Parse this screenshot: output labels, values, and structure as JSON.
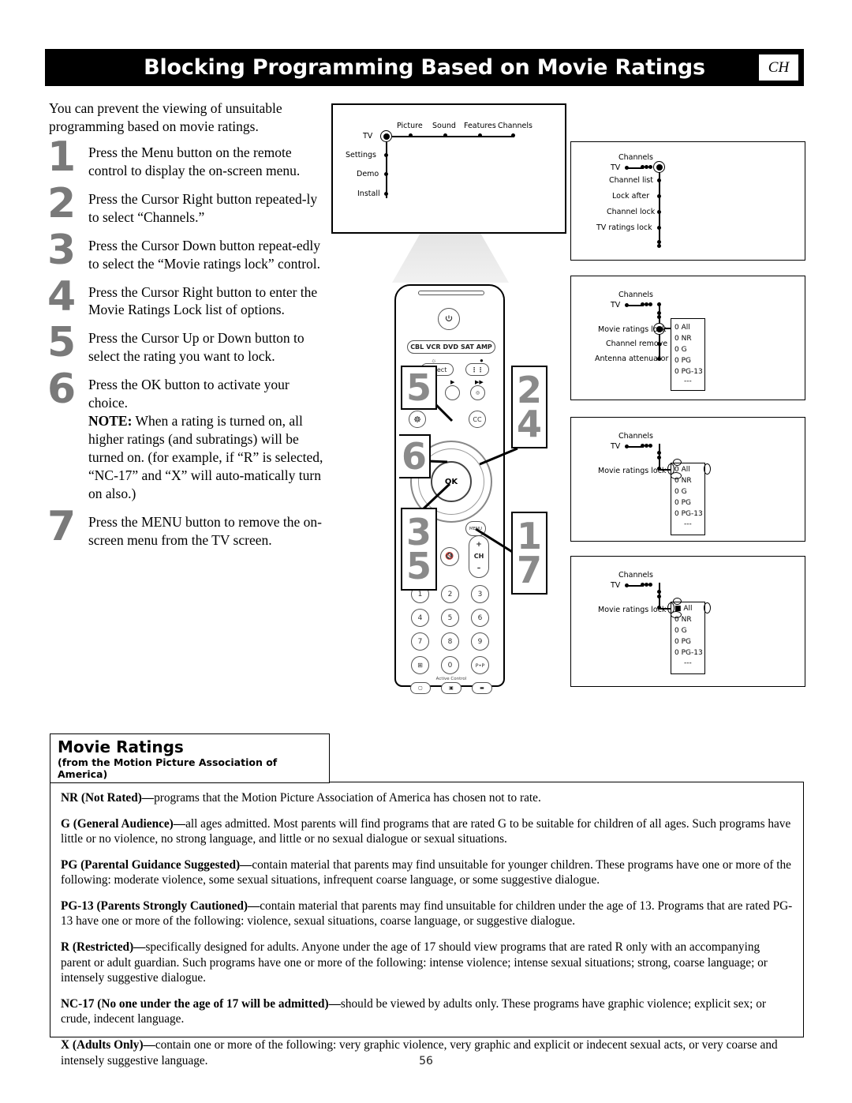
{
  "header": {
    "title": "Blocking Programming Based on Movie Ratings",
    "tab_label": "CH"
  },
  "intro": "You can prevent the viewing of unsuitable programming based on movie ratings.",
  "steps": [
    {
      "num": "1",
      "text": "Press the Menu button on the remote control to display the on-screen menu."
    },
    {
      "num": "2",
      "text": "Press the Cursor Right button repeated-ly to select “Channels.”"
    },
    {
      "num": "3",
      "text": "Press the Cursor Down button repeat-edly to select the “Movie ratings lock” control."
    },
    {
      "num": "4",
      "text": "Press the Cursor Right button to enter the Movie Ratings Lock list of options."
    },
    {
      "num": "5",
      "text": "Press the Cursor Up or Down button to select the rating you want to lock."
    },
    {
      "num": "6",
      "text": "Press the OK button to activate your choice.",
      "note_label": "NOTE:",
      "note": " When a rating is turned on, all higher ratings (and subratings) will be turned on. (for example, if “R” is selected, “NC-17” and “X” will auto-matically turn on also.)"
    },
    {
      "num": "7",
      "text": "Press the MENU button to remove the on-screen menu from the TV screen."
    }
  ],
  "tv_menu": {
    "root": "TV",
    "across": [
      "Picture",
      "Sound",
      "Features",
      "Channels"
    ],
    "down": [
      "Settings",
      "Demo",
      "Install"
    ]
  },
  "panels": [
    {
      "id": "panel-channels",
      "root": "TV",
      "hub_label": "Channels",
      "items": [
        "Channel list",
        "Lock after",
        "Channel lock",
        "TV ratings lock"
      ]
    },
    {
      "id": "panel-movie-ratings-lock",
      "root": "TV",
      "hub_label": "Channels",
      "items": [
        "Movie ratings lock",
        "Channel remove",
        "Antenna attenuator"
      ],
      "options": [
        "All",
        "NR",
        "G",
        "PG",
        "PG-13",
        "---"
      ]
    },
    {
      "id": "panel-select-rating",
      "root": "TV",
      "hub_label": "Channels",
      "items": [
        "Movie ratings lock"
      ],
      "options": [
        "All",
        "NR",
        "G",
        "PG",
        "PG-13",
        "---"
      ]
    },
    {
      "id": "panel-rating-activated",
      "root": "TV",
      "hub_label": "Channels",
      "items": [
        "Movie ratings lock"
      ],
      "options": [
        "All",
        "NR",
        "G",
        "PG",
        "PG-13",
        "---"
      ]
    }
  ],
  "remote": {
    "power_icon": "power-icon",
    "mode_buttons": [
      "CBL",
      "VCR",
      "DVD",
      "SAT",
      "AMP"
    ],
    "select_label": "Select",
    "ok_label": "OK",
    "menu_label": "MENU",
    "cc_label": "CC",
    "volume_label": "",
    "channel_label": "CH",
    "plus_label": "+",
    "minus_label": "–",
    "pip_label": "P•P",
    "active_control_label": "Active Control",
    "keypad": [
      "1",
      "2",
      "3",
      "4",
      "5",
      "6",
      "7",
      "8",
      "9",
      "0"
    ]
  },
  "callouts": [
    {
      "id": "callout-5",
      "numbers": [
        "5"
      ]
    },
    {
      "id": "callout-2-4",
      "numbers": [
        "2",
        "4"
      ]
    },
    {
      "id": "callout-6",
      "numbers": [
        "6"
      ]
    },
    {
      "id": "callout-3-5",
      "numbers": [
        "3",
        "5"
      ]
    },
    {
      "id": "callout-1-7",
      "numbers": [
        "1",
        "7"
      ]
    }
  ],
  "movie_ratings": {
    "title": "Movie Ratings",
    "subtitle": "(from the Motion Picture Association of America)",
    "entries": [
      {
        "term": "NR (Not Rated)—",
        "desc": "programs that the Motion Picture Association of America has chosen not to rate."
      },
      {
        "term": "G (General Audience)—",
        "desc": "all ages admitted. Most parents will find programs that are rated G to be suitable for children of all ages. Such programs have little or no violence, no strong language, and little or no sexual dialogue or sexual situations."
      },
      {
        "term": "PG (Parental Guidance Suggested)—",
        "desc": "contain material that parents may find unsuitable for younger children. These programs have one or more of the following: moderate violence, some sexual situations, infrequent coarse language, or some suggestive dialogue."
      },
      {
        "term": "PG-13 (Parents Strongly Cautioned)—",
        "desc": "contain material that parents may find unsuitable for children under the age of 13. Programs that are rated PG-13 have one or more of the following: violence, sexual situations, coarse language, or suggestive dialogue."
      },
      {
        "term": "R (Restricted)—",
        "desc": "specifically designed for adults. Anyone under the age of 17 should view programs that are rated R only with an accompanying parent or adult guardian. Such programs have one or more of the following: intense violence; intense sexual situations; strong, coarse language; or intensely suggestive dialogue."
      },
      {
        "term": "NC-17 (No one under the age of 17 will be admitted)—",
        "desc": "should be viewed by adults only. These programs have graphic violence; explicit sex; or crude, indecent language."
      },
      {
        "term": "X (Adults Only)—",
        "desc": "contain one or more of the following: very graphic violence, very graphic and explicit or indecent sexual acts, or very coarse and intensely suggestive language."
      }
    ]
  },
  "page_number": "56",
  "colors": {
    "header_bg": "#000000",
    "callout_number": "#8a8a8a",
    "step_number": "#7a7a7a"
  }
}
